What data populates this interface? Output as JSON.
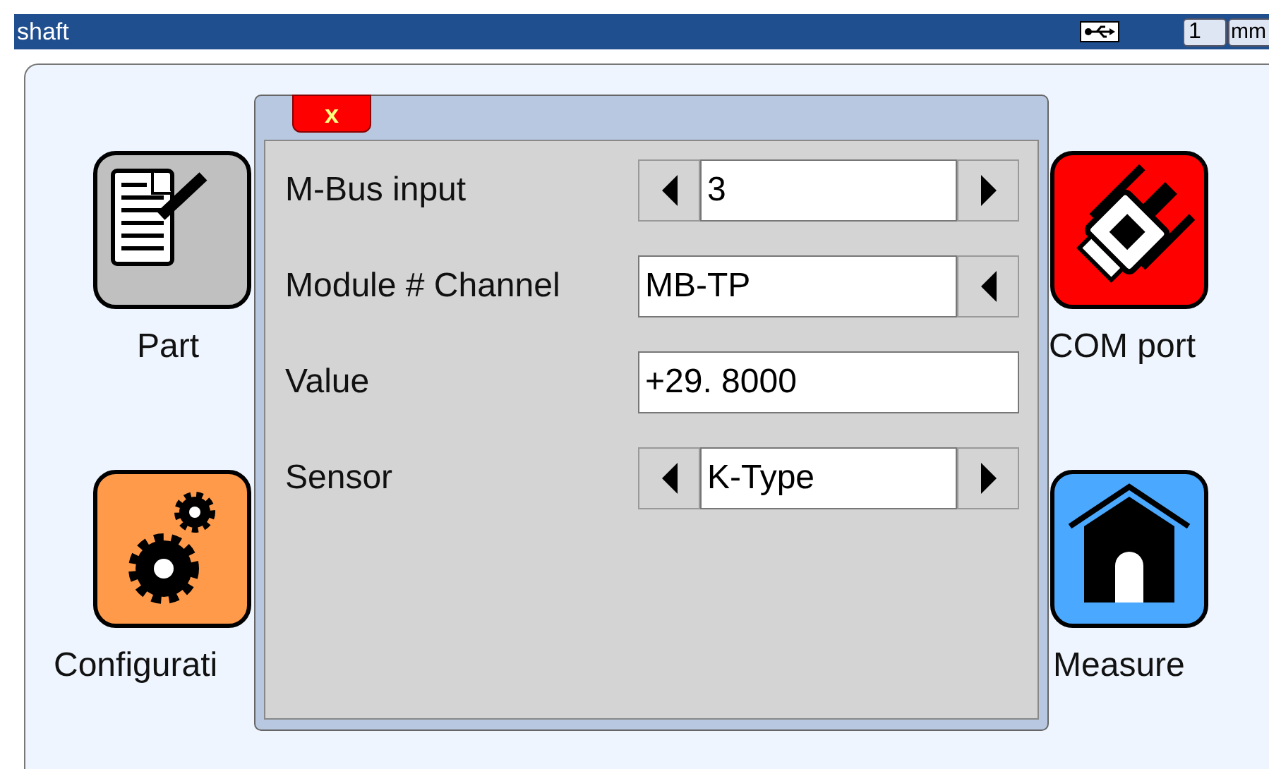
{
  "title_bar": {
    "title": "shaft",
    "value": "1",
    "unit": "mm"
  },
  "apps": [
    {
      "label": "Part",
      "kind": "part"
    },
    {
      "label": "COM port",
      "kind": "com"
    },
    {
      "label": "Configurati",
      "kind": "config"
    },
    {
      "label": "Measure",
      "kind": "measure"
    }
  ],
  "dialog": {
    "close": "x",
    "fields": [
      {
        "label": "M-Bus input",
        "kind": "spinner",
        "value": "3"
      },
      {
        "label": "Module # Channel",
        "kind": "dropdown",
        "value": "MB-TP"
      },
      {
        "label": "Value",
        "kind": "text",
        "value": "+29. 8000"
      },
      {
        "label": "Sensor",
        "kind": "spinner",
        "value": "K-Type"
      }
    ]
  }
}
